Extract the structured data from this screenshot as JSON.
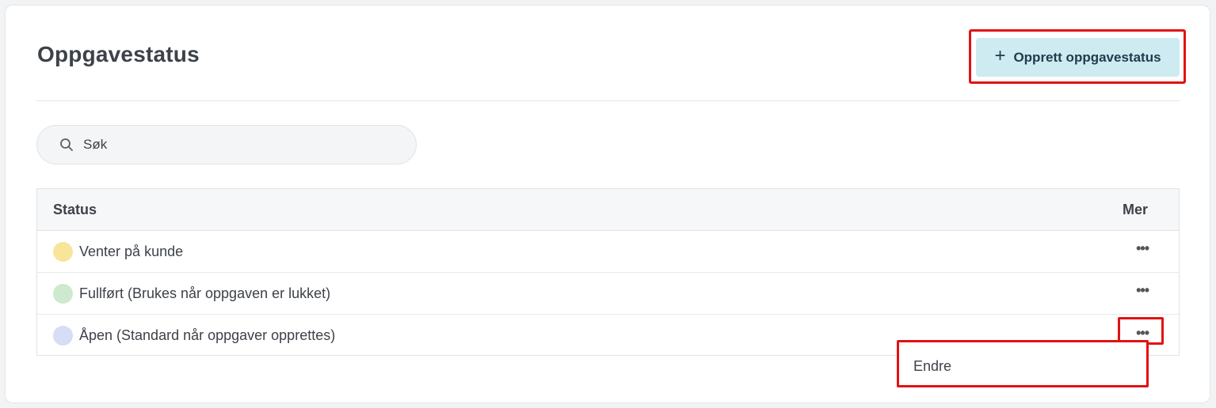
{
  "page": {
    "title": "Oppgavestatus",
    "create_button": "Opprett oppgavestatus"
  },
  "search": {
    "placeholder": "Søk"
  },
  "table": {
    "headers": {
      "status": "Status",
      "more": "Mer"
    },
    "rows": [
      {
        "label": "Venter på kunde",
        "color": "#f8e59a",
        "more": "•••"
      },
      {
        "label": "Fullført (Brukes når oppgaven er lukket)",
        "color": "#cde9cf",
        "more": "•••"
      },
      {
        "label": "Åpen (Standard når oppgaver opprettes)",
        "color": "#d5def5",
        "more": "•••"
      }
    ]
  },
  "context_menu": {
    "items": [
      "Endre"
    ]
  },
  "colors": {
    "accent_button_bg": "#cdebf0",
    "highlight": "#e11212"
  }
}
